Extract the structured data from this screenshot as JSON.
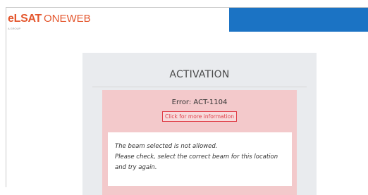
{
  "header": {
    "logo_brand": "eLSAT",
    "logo_product": "ONEWEB",
    "logo_sub": "A GROUP",
    "band_color": "#1b73c4",
    "brand_color": "#e4572e"
  },
  "activation": {
    "title": "ACTIVATION",
    "error_code": "Error: ACT-1104",
    "more_info_link": "Click for more information",
    "message_lines": [
      "The beam selected is not allowed.",
      "Please check, select the correct beam for this location",
      "and try again."
    ],
    "error_bg_color": "#f3c9cb",
    "link_color": "#e0404a"
  }
}
